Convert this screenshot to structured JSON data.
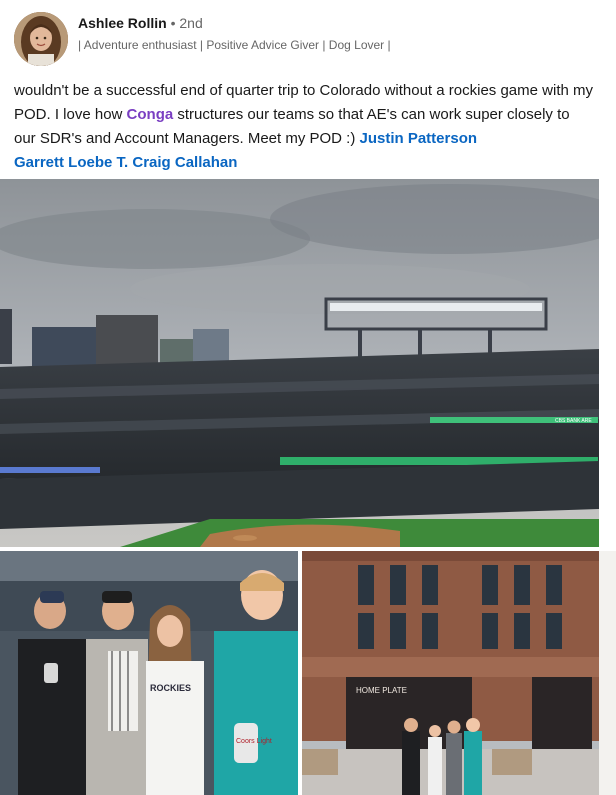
{
  "author": {
    "name": "Ashlee Rollin",
    "degree": "• 2nd",
    "headline": "| Adventure enthusiast | Positive Advice Giver | Dog Lover |",
    "avatar_icon": "profile-photo"
  },
  "post": {
    "text_1": "wouldn't be a successful end of quarter trip to Colorado without a rockies game with my POD. I love how ",
    "company": "Conga",
    "text_2": " structures our teams so that AE's can work super closely to our SDR's and Account Managers. Meet my POD :) ",
    "mention_1": "Justin Patterson",
    "mention_2": "Garrett Loebe",
    "mention_3": "T. Craig Callahan"
  },
  "images": {
    "main": "stadium-photo",
    "left": "friends-selfie-photo",
    "right": "ballpark-entrance-photo"
  },
  "signage": {
    "gate": "HOME PLATE",
    "board": "CBS BANK ARE",
    "can": "Coors Light",
    "jersey": "ROCKIES"
  },
  "colors": {
    "mention": "#0a66c2",
    "company": "#7a3fc2",
    "secondary_text": "#666666"
  }
}
